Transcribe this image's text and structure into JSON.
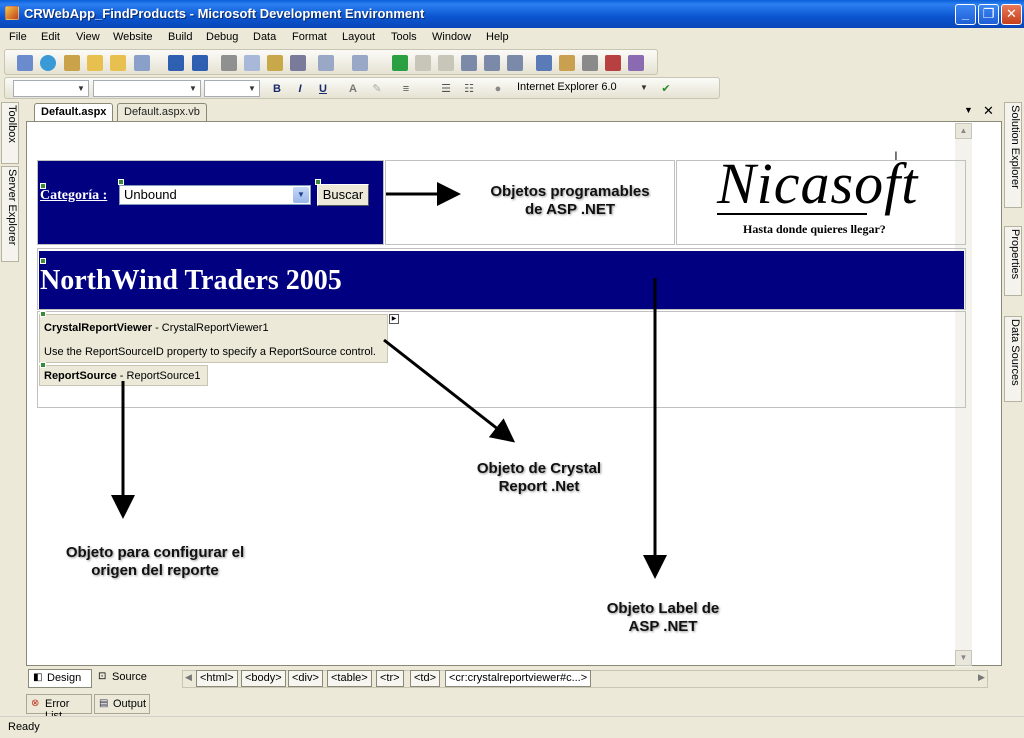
{
  "window": {
    "title": "CRWebApp_FindProducts - Microsoft Development Environment",
    "minimize": "_",
    "restore": "❐",
    "close": "✕"
  },
  "menu": [
    "File",
    "Edit",
    "View",
    "Website",
    "Build",
    "Debug",
    "Data",
    "Format",
    "Layout",
    "Tools",
    "Window",
    "Help"
  ],
  "toolbar2": {
    "browser_target": "Internet Explorer 6.0",
    "bold": "B",
    "italic": "I",
    "underline": "U"
  },
  "left_panels": [
    "Toolbox",
    "Server Explorer"
  ],
  "right_panels": [
    "Solution Explorer",
    "Properties",
    "Data Sources"
  ],
  "doc_tabs": [
    "Default.aspx",
    "Default.aspx.vb"
  ],
  "page": {
    "category_label": "Categoría :",
    "category_value": "Unbound",
    "search_button": "Buscar",
    "logo_text": "Nicasoft",
    "logo_tagline": "Hasta donde quieres llegar?",
    "banner_title": "NorthWind Traders 2005",
    "crv_name": "CrystalReportViewer",
    "crv_id": " - CrystalReportViewer1",
    "crv_hint": "Use the ReportSourceID property to specify a ReportSource control.",
    "rs_name": "ReportSource",
    "rs_id": " - ReportSource1"
  },
  "annotations": {
    "asp_objects": "Objetos programables\nde ASP .NET",
    "crystal": "Objeto de Crystal\nReport .Net",
    "report_source": "Objeto para configurar el\norigen del reporte",
    "label": "Objeto Label de\nASP .NET"
  },
  "view": {
    "design": "Design",
    "source": "Source",
    "tags": [
      "<html>",
      "<body>",
      "<div>",
      "<table>",
      "<tr>",
      "<td>",
      "<cr:crystalreportviewer#c...>"
    ]
  },
  "pane_tabs": [
    "Error List",
    "Output"
  ],
  "status": "Ready"
}
